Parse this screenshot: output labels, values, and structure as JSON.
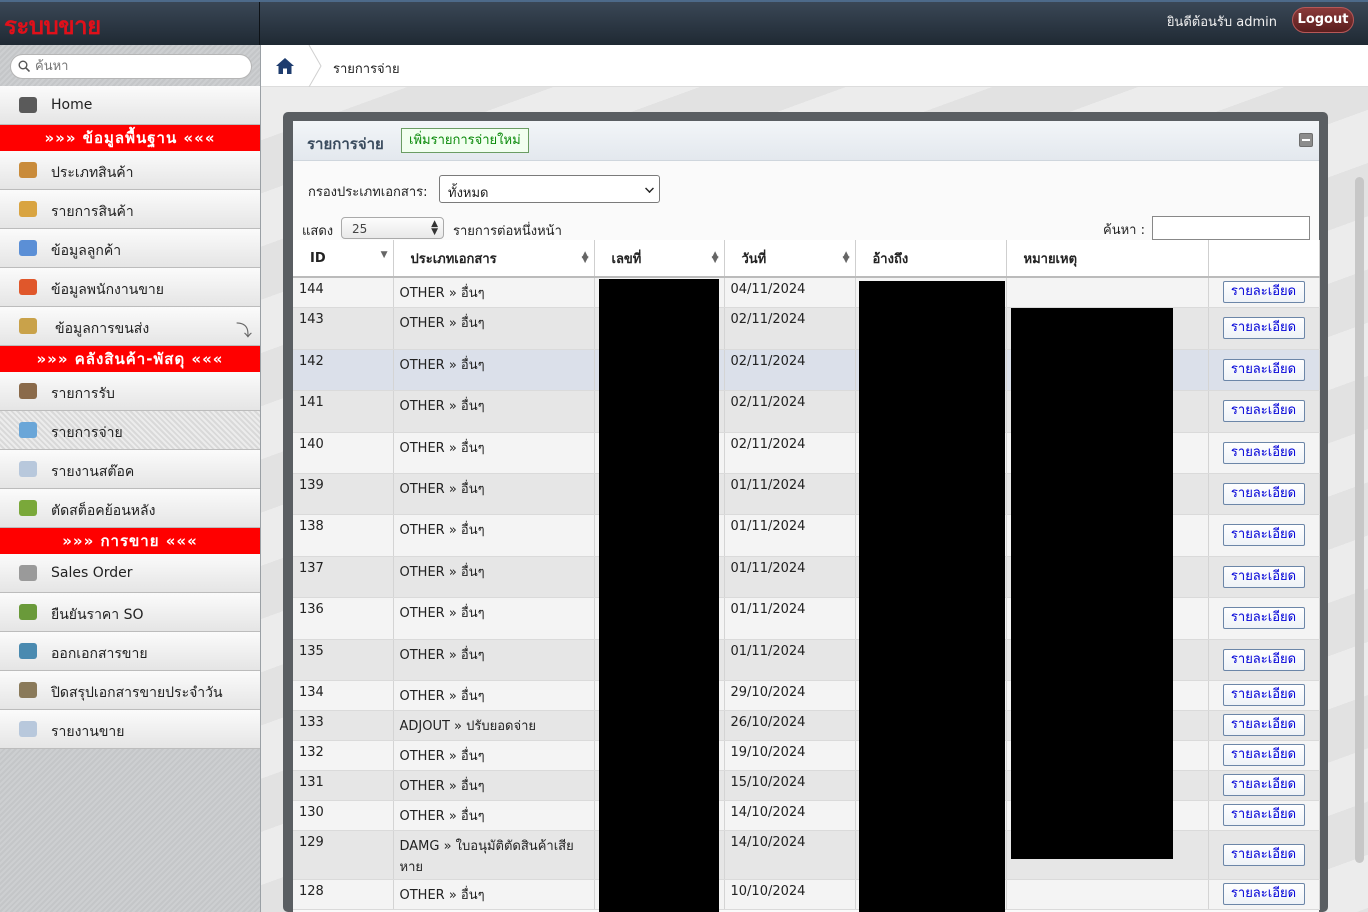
{
  "app": {
    "brand": "ระบบขาย",
    "welcome": "ยินดีต้อนรับ admin",
    "logout_label": "Logout"
  },
  "sidebar": {
    "search_placeholder": "ค้นหา",
    "items": [
      {
        "type": "item",
        "label": "Home",
        "icon": "helmet-icon",
        "color": "#5a5a5a"
      },
      {
        "type": "section",
        "label": "»»» ข้อมูลพื้นฐาน «««"
      },
      {
        "type": "item",
        "label": "ประเภทสินค้า",
        "icon": "boxes-icon",
        "color": "#c98b3a"
      },
      {
        "type": "item",
        "label": "รายการสินค้า",
        "icon": "package-icon",
        "color": "#d9a441"
      },
      {
        "type": "item",
        "label": "ข้อมูลลูกค้า",
        "icon": "users-icon",
        "color": "#5b8fd6"
      },
      {
        "type": "item",
        "label": "ข้อมูลพนักงานขาย",
        "icon": "salesman-icon",
        "color": "#e0572b"
      },
      {
        "type": "item",
        "label": "ข้อมูลการขนส่ง",
        "icon": "truck-icon",
        "color": "#c9a24a",
        "arrow": true
      },
      {
        "type": "section",
        "label": "»»» คลังสินค้า-พัสดุ «««"
      },
      {
        "type": "item",
        "label": "รายการรับ",
        "icon": "receive-icon",
        "color": "#8a6a4a"
      },
      {
        "type": "item",
        "label": "รายการจ่าย",
        "icon": "issue-icon",
        "color": "#6aa6d8",
        "active": true
      },
      {
        "type": "item",
        "label": "รายงานสต๊อค",
        "icon": "document-icon",
        "color": "#b8c8dc"
      },
      {
        "type": "item",
        "label": "ตัดสต็อคย้อนหลัง",
        "icon": "basket-icon",
        "color": "#7aa83a"
      },
      {
        "type": "section",
        "label": "»»» การขาย «««"
      },
      {
        "type": "item",
        "label": "Sales Order",
        "icon": "window-icon",
        "color": "#9a9a9a"
      },
      {
        "type": "item",
        "label": "ยืนยันราคา SO",
        "icon": "confirm-users-icon",
        "color": "#6a9a3a"
      },
      {
        "type": "item",
        "label": "ออกเอกสารขาย",
        "icon": "register-icon",
        "color": "#4a8ab0"
      },
      {
        "type": "item",
        "label": "ปิดสรุปเอกสารขายประจำวัน",
        "icon": "report-icon",
        "color": "#8a7a5a"
      },
      {
        "type": "item",
        "label": "รายงานขาย",
        "icon": "document-icon",
        "color": "#b8c8dc"
      }
    ]
  },
  "breadcrumb": {
    "current": "รายการจ่าย"
  },
  "panel": {
    "title": "รายการจ่าย",
    "add_label": "เพิ่มรายการจ่ายใหม่",
    "filter_label": "กรองประเภทเอกสาร:",
    "filter_value": "ทั้งหมด",
    "show_label": "แสดง",
    "page_size": "25",
    "per_page_label": "รายการต่อหนึ่งหน้า",
    "search_label": "ค้นหา :"
  },
  "table": {
    "headers": [
      "ID",
      "ประเภทเอกสาร",
      "เลขที่",
      "วันที่",
      "อ้างถึง",
      "หมายเหตุ",
      ""
    ],
    "detail_label": "รายละเอียด",
    "rows": [
      {
        "id": "144",
        "type": "OTHER » อื่นๆ",
        "date": "04/11/2024"
      },
      {
        "id": "143",
        "type": "OTHER » อื่นๆ",
        "date": "02/11/2024"
      },
      {
        "id": "142",
        "type": "OTHER » อื่นๆ",
        "date": "02/11/2024"
      },
      {
        "id": "141",
        "type": "OTHER » อื่นๆ",
        "date": "02/11/2024"
      },
      {
        "id": "140",
        "type": "OTHER » อื่นๆ",
        "date": "02/11/2024"
      },
      {
        "id": "139",
        "type": "OTHER » อื่นๆ",
        "date": "01/11/2024"
      },
      {
        "id": "138",
        "type": "OTHER » อื่นๆ",
        "date": "01/11/2024"
      },
      {
        "id": "137",
        "type": "OTHER » อื่นๆ",
        "date": "01/11/2024"
      },
      {
        "id": "136",
        "type": "OTHER » อื่นๆ",
        "date": "01/11/2024"
      },
      {
        "id": "135",
        "type": "OTHER » อื่นๆ",
        "date": "01/11/2024"
      },
      {
        "id": "134",
        "type": "OTHER » อื่นๆ",
        "date": "29/10/2024"
      },
      {
        "id": "133",
        "type": "ADJOUT » ปรับยอดจ่าย",
        "date": "26/10/2024"
      },
      {
        "id": "132",
        "type": "OTHER » อื่นๆ",
        "date": "19/10/2024"
      },
      {
        "id": "131",
        "type": "OTHER » อื่นๆ",
        "date": "15/10/2024"
      },
      {
        "id": "130",
        "type": "OTHER » อื่นๆ",
        "date": "14/10/2024"
      },
      {
        "id": "129",
        "type": "DAMG » ใบอนุมัติตัดสินค้าเสียหาย",
        "date": "14/10/2024"
      },
      {
        "id": "128",
        "type": "OTHER » อื่นๆ",
        "date": "10/10/2024"
      }
    ]
  }
}
